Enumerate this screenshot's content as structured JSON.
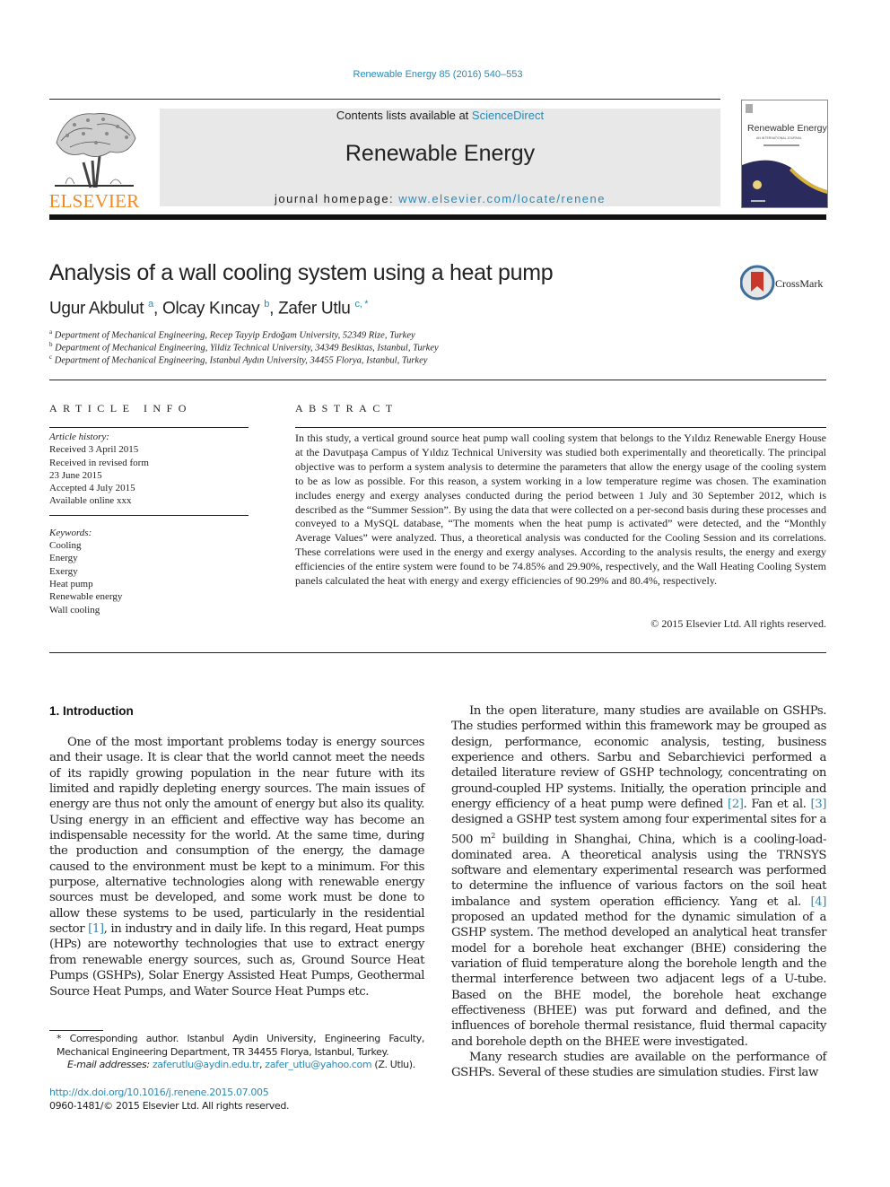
{
  "journal_ref": "Renewable Energy 85 (2016) 540–553",
  "masthead": {
    "publisher": "ELSEVIER",
    "contents_prefix": "Contents lists available at ",
    "contents_link": "ScienceDirect",
    "journal_name": "Renewable Energy",
    "homepage_prefix": "journal homepage: ",
    "homepage_link": "www.elsevier.com/locate/renene",
    "cover_title": "Renewable Energy",
    "cover_subtitle": "AN INTERNATIONAL JOURNAL",
    "colors": {
      "link": "#2a8ab5",
      "publisher": "#f08a24",
      "cover_navy": "#2b2a5c",
      "cover_gold": "#d9b23a"
    }
  },
  "article": {
    "title": "Analysis of a wall cooling system using a heat pump",
    "crossmark_label": "CrossMark",
    "authors": [
      {
        "name": "Ugur Akbulut",
        "sup": "a"
      },
      {
        "name": "Olcay Kıncay",
        "sup": "b"
      },
      {
        "name": "Zafer Utlu",
        "sup": "c, *"
      }
    ],
    "affiliations": [
      {
        "sup": "a",
        "text": "Department of Mechanical Engineering, Recep Tayyip Erdoğam University, 52349 Rize, Turkey"
      },
      {
        "sup": "b",
        "text": "Department of Mechanical Engineering, Yildiz Technical University, 34349 Besiktas, Istanbul, Turkey"
      },
      {
        "sup": "c",
        "text": "Department of Mechanical Engineering, Istanbul Aydın University, 34455 Florya, Istanbul, Turkey"
      }
    ]
  },
  "article_info": {
    "heading": "ARTICLE INFO",
    "history_label": "Article history:",
    "history": [
      "Received 3 April 2015",
      "Received in revised form",
      "23 June 2015",
      "Accepted 4 July 2015",
      "Available online xxx"
    ],
    "keywords_label": "Keywords:",
    "keywords": [
      "Cooling",
      "Energy",
      "Exergy",
      "Heat pump",
      "Renewable energy",
      "Wall cooling"
    ]
  },
  "abstract": {
    "heading": "ABSTRACT",
    "text": "In this study, a vertical ground source heat pump wall cooling system that belongs to the Yıldız Renewable Energy House at the Davutpaşa Campus of Yıldız Technical University was studied both experimentally and theoretically. The principal objective was to perform a system analysis to determine the parameters that allow the energy usage of the cooling system to be as low as possible. For this reason, a system working in a low temperature regime was chosen. The examination includes energy and exergy analyses conducted during the period between 1 July and 30 September 2012, which is described as the “Summer Session”. By using the data that were collected on a per-second basis during these processes and conveyed to a MySQL database, “The moments when the heat pump is activated” were detected, and the “Monthly Average Values” were analyzed. Thus, a theoretical analysis was conducted for the Cooling Session and its correlations. These correlations were used in the energy and exergy analyses. According to the analysis results, the energy and exergy efficiencies of the entire system were found to be 74.85% and 29.90%, respectively, and the Wall Heating Cooling System panels calculated the heat with energy and exergy efficiencies of 90.29% and 80.4%, respectively.",
    "copyright": "© 2015 Elsevier Ltd. All rights reserved."
  },
  "body": {
    "intro_heading": "1.  Introduction",
    "left_p1_a": "One of the most important problems today is energy sources and their usage. It is clear that the world cannot meet the needs of its rapidly growing population in the near future with its limited and rapidly depleting energy sources. The main issues of energy are thus not only the amount of energy but also its quality. Using energy in an efficient and effective way has become an indispensable necessity for the world. At the same time, during the production and consumption of the energy, the damage caused to the environment must be kept to a minimum. For this purpose, alternative technologies along with renewable energy sources must be developed, and some work must be done to allow these systems to be used, particularly in the residential sector ",
    "left_cite1": "[1]",
    "left_p1_b": ", in industry and in daily life. In this regard, Heat pumps (HPs) are noteworthy technologies that use to extract energy from renewable energy sources, such as, Ground Source Heat Pumps (GSHPs), Solar Energy Assisted Heat Pumps, Geothermal Source Heat Pumps, and Water Source Heat Pumps etc.",
    "right_p1_a": "In the open literature, many studies are available on GSHPs. The studies performed within this framework may be grouped as design, performance, economic analysis, testing, business experience and others. Sarbu and Sebarchievici performed a detailed literature review of GSHP technology, concentrating on ground-coupled HP systems. Initially, the operation principle and energy efficiency of a heat pump were defined ",
    "right_cite2": "[2]",
    "right_p1_b": ". Fan et al. ",
    "right_cite3": "[3]",
    "right_p1_c": " designed a GSHP test system among four experimental sites for a 500 m",
    "right_p1_sup": "2",
    "right_p1_d": " building in Shanghai, China, which is a cooling-load-dominated area. A theoretical analysis using the TRNSYS software and elementary experimental research was performed to determine the influence of various factors on the soil heat imbalance and system operation efficiency. Yang et al. ",
    "right_cite4": "[4]",
    "right_p1_e": " proposed an updated method for the dynamic simulation of a GSHP system. The method developed an analytical heat transfer model for a borehole heat exchanger (BHE) considering the variation of fluid temperature along the borehole length and the thermal interference between two adjacent legs of a U-tube. Based on the BHE model, the borehole heat exchange effectiveness (BHEE) was put forward and defined, and the influences of borehole thermal resistance, fluid thermal capacity and borehole depth on the BHEE were investigated.",
    "right_p2": "Many research studies are available on the performance of GSHPs. Several of these studies are simulation studies. First law"
  },
  "footnote": {
    "corresponding": "* Corresponding author. Istanbul Aydin University, Engineering Faculty, Mechanical Engineering Department, TR 34455 Florya, Istanbul, Turkey.",
    "email_label": "E-mail addresses:",
    "email1": "zaferutlu@aydin.edu.tr",
    "email2": "zafer_utlu@yahoo.com",
    "email_suffix": " (Z. Utlu).",
    "doi": "http://dx.doi.org/10.1016/j.renene.2015.07.005",
    "issn": "0960-1481/© 2015 Elsevier Ltd. All rights reserved."
  }
}
